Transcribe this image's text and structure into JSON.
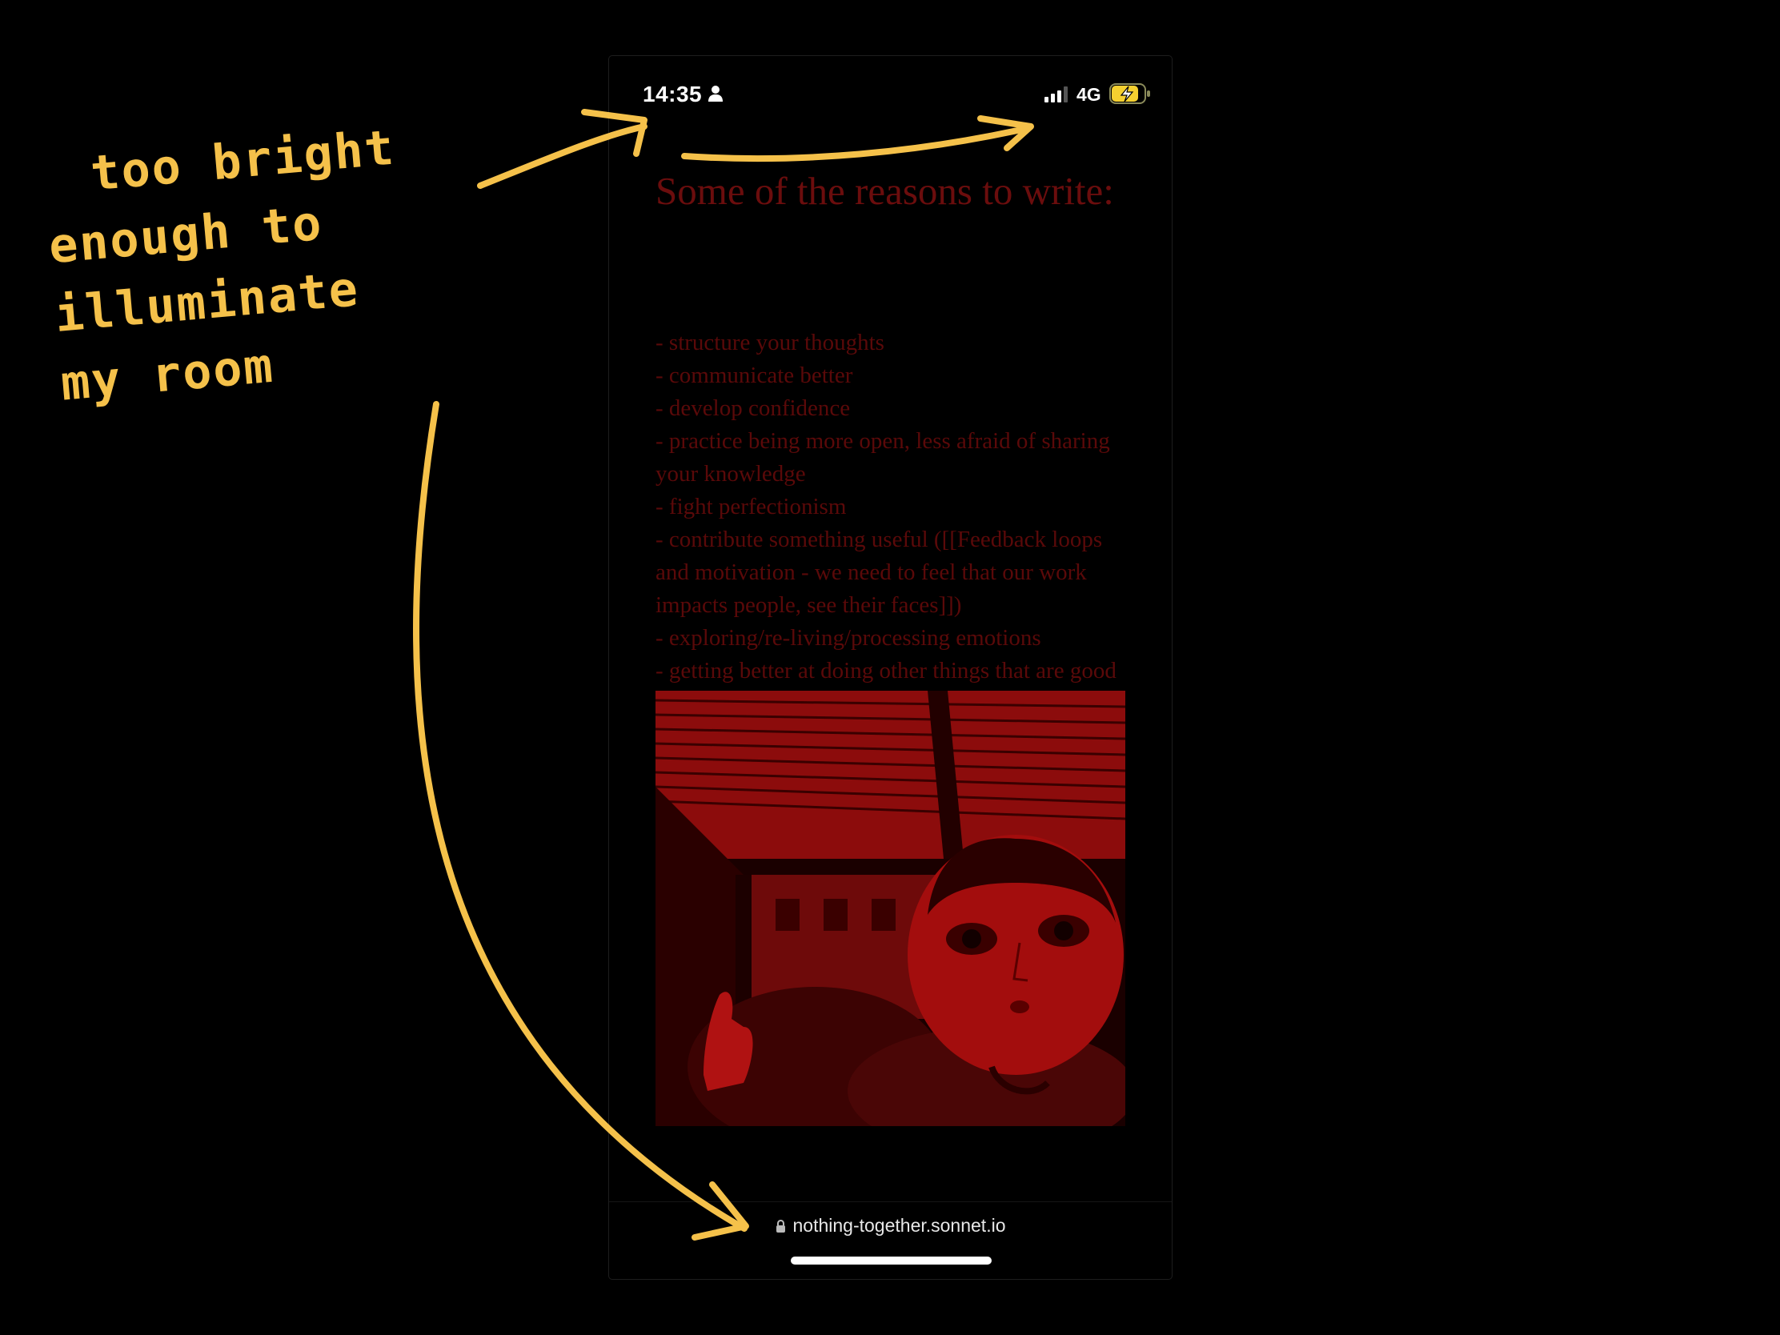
{
  "status_bar": {
    "time": "14:35",
    "network": "4G",
    "person_icon": "person-icon",
    "signal_icon": "cellular-signal-icon",
    "battery_icon": "battery-charging-icon",
    "battery_color": "#f5d030"
  },
  "article": {
    "title": "Some of the reasons to write:",
    "reasons": [
      "- structure your thoughts",
      "- communicate better",
      "- develop confidence",
      "- practice being more open, less afraid of sharing your knowledge",
      "- fight perfectionism",
      "- contribute something useful ([[Feedback loops and motivation - we need to feel that our work impacts people, see their faces]])",
      "- exploring/re-living/processing emotions",
      "- getting better at doing other things that are good for you, but require consistency"
    ],
    "text_color": "#5a0909"
  },
  "address_bar": {
    "url": "nothing-together.sonnet.io",
    "lock_icon": "lock-icon"
  },
  "annotation": {
    "lines": [
      "too bright",
      "enough to illuminate",
      "my room"
    ],
    "ink_color": "#f5c14a"
  }
}
